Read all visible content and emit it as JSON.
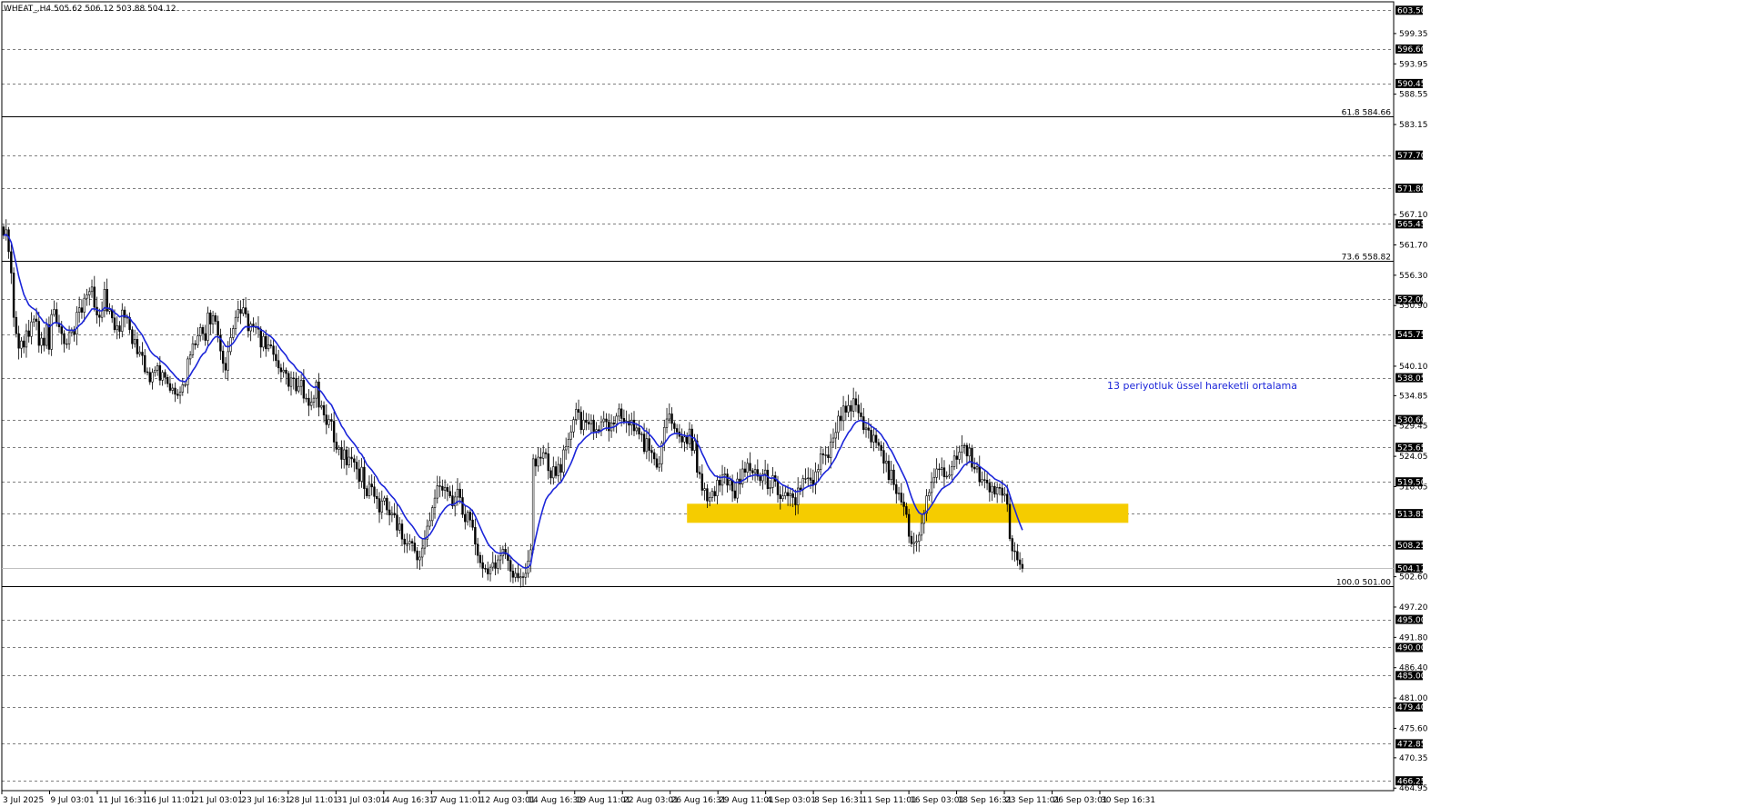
{
  "header": {
    "symbol_info": "WHEAT_,H4 505.62 506.12 503.88 504.12"
  },
  "annotation": {
    "ema_label": "13 periyotluk üssel hareketli ortalama"
  },
  "colors": {
    "background": "#ffffff",
    "candle": "#000000",
    "ema": "#1b25d9",
    "zone": "#f5cc00",
    "tag_bg": "#000000",
    "tag_text": "#ffffff",
    "grid": "#000000"
  },
  "chart_data": {
    "type": "candlestick",
    "symbol": "WHEAT_",
    "timeframe": "H4",
    "ylim": [
      464.5,
      605.0
    ],
    "y_ticks": [
      "599.35",
      "593.95",
      "588.55",
      "583.15",
      "567.10",
      "561.70",
      "556.30",
      "550.90",
      "540.10",
      "534.85",
      "529.45",
      "524.05",
      "518.65",
      "502.60",
      "497.20",
      "491.80",
      "486.40",
      "481.00",
      "475.60",
      "470.35",
      "464.95"
    ],
    "level_tags": [
      {
        "price": 603.5,
        "label": "603.50"
      },
      {
        "price": 596.6,
        "label": "596.60"
      },
      {
        "price": 590.45,
        "label": "590.45"
      },
      {
        "price": 577.7,
        "label": "577.70"
      },
      {
        "price": 571.8,
        "label": "571.80"
      },
      {
        "price": 565.45,
        "label": "565.45"
      },
      {
        "price": 552.0,
        "label": "552.00"
      },
      {
        "price": 545.75,
        "label": "545.75"
      },
      {
        "price": 538.05,
        "label": "538.05"
      },
      {
        "price": 530.6,
        "label": "530.60"
      },
      {
        "price": 525.65,
        "label": "525.65"
      },
      {
        "price": 519.5,
        "label": "519.50"
      },
      {
        "price": 513.85,
        "label": "513.85"
      },
      {
        "price": 508.25,
        "label": "508.25"
      },
      {
        "price": 504.12,
        "label": "504.12"
      },
      {
        "price": 495.0,
        "label": "495.00"
      },
      {
        "price": 490.0,
        "label": "490.00"
      },
      {
        "price": 485.0,
        "label": "485.00"
      },
      {
        "price": 479.4,
        "label": "479.40"
      },
      {
        "price": 472.85,
        "label": "472.85"
      },
      {
        "price": 466.25,
        "label": "466.25"
      }
    ],
    "dashed_levels": [
      603.5,
      596.6,
      590.45,
      577.7,
      571.8,
      565.45,
      552.0,
      545.75,
      538.05,
      530.6,
      525.65,
      519.5,
      513.85,
      508.25,
      495.0,
      490.0,
      485.0,
      479.4,
      472.85,
      466.25
    ],
    "current_price": 504.12,
    "fib_levels": [
      {
        "price": 584.66,
        "label": "61.8 584.66"
      },
      {
        "price": 558.82,
        "label": "73.6 558.82"
      },
      {
        "price": 501.0,
        "label": "100.0 501.00"
      }
    ],
    "x_labels": [
      "3 Jul 2025",
      "9 Jul 03:01",
      "11 Jul 16:31",
      "16 Jul 11:01",
      "21 Jul 03:01",
      "23 Jul 16:31",
      "28 Jul 11:01",
      "31 Jul 03:01",
      "4 Aug 16:31",
      "7 Aug 11:01",
      "12 Aug 03:01",
      "14 Aug 16:31",
      "19 Aug 11:01",
      "22 Aug 03:01",
      "26 Aug 16:31",
      "29 Aug 11:01",
      "4 Sep 03:01",
      "8 Sep 16:31",
      "11 Sep 11:01",
      "16 Sep 03:01",
      "18 Sep 16:31",
      "23 Sep 11:01",
      "26 Sep 03:01",
      "30 Sep 16:31"
    ],
    "zone": {
      "top": 515.6,
      "bottom": 512.2,
      "start_bar": 271,
      "end_bar": 446
    },
    "ema_label": "13 periyotluk üssel hareketli ortalama",
    "closes": [
      563.4,
      564.4,
      560.5,
      556.7,
      548.8,
      545.9,
      543.3,
      544.6,
      543.5,
      546.4,
      545.4,
      548.0,
      548.5,
      548.1,
      543.8,
      545.1,
      543.8,
      547.5,
      543.1,
      549.3,
      550.2,
      547.8,
      547.1,
      545.9,
      544.1,
      544.1,
      546.1,
      546.6,
      545.8,
      549.7,
      550.5,
      549.7,
      552.2,
      552.8,
      553.4,
      554.2,
      550.6,
      549.2,
      548.8,
      550.0,
      553.8,
      549.9,
      550.2,
      548.7,
      546.6,
      547.3,
      546.3,
      550.1,
      548.8,
      548.8,
      546.6,
      544.1,
      544.9,
      542.3,
      542.6,
      542.0,
      539.1,
      539.0,
      537.3,
      539.0,
      539.4,
      540.2,
      537.6,
      539.0,
      538.1,
      537.0,
      535.8,
      536.2,
      535.1,
      534.9,
      535.5,
      536.8,
      536.8,
      541.4,
      542.1,
      544.1,
      543.9,
      545.5,
      547.0,
      545.9,
      544.7,
      549.6,
      547.6,
      549.1,
      548.1,
      545.6,
      542.8,
      540.6,
      539.4,
      542.7,
      545.2,
      546.8,
      548.8,
      550.2,
      549.5,
      550.5,
      549.4,
      546.4,
      547.6,
      547.1,
      547.1,
      546.7,
      543.5,
      545.4,
      543.2,
      543.9,
      543.7,
      542.2,
      541.1,
      539.8,
      539.1,
      539.4,
      538.8,
      536.5,
      538.0,
      537.9,
      535.7,
      536.5,
      537.6,
      534.4,
      534.4,
      533.1,
      533.7,
      534.4,
      537.3,
      532.8,
      533.1,
      531.4,
      529.7,
      530.6,
      530.3,
      526.6,
      525.3,
      525.6,
      523.5,
      525.2,
      522.5,
      523.9,
      523.6,
      523.0,
      521.8,
      519.6,
      522.1,
      518.3,
      517.0,
      519.1,
      518.6,
      516.9,
      516.5,
      514.1,
      516.1,
      516.6,
      514.5,
      513.6,
      513.9,
      513.6,
      510.9,
      512.0,
      509.3,
      508.4,
      508.5,
      508.9,
      508.6,
      507.2,
      505.6,
      506.1,
      507.7,
      509.3,
      511.6,
      512.6,
      514.9,
      516.6,
      518.8,
      518.7,
      518.0,
      518.5,
      517.8,
      517.0,
      515.2,
      516.8,
      518.2,
      516.7,
      513.7,
      512.4,
      514.1,
      512.7,
      511.4,
      508.4,
      506.4,
      505.1,
      504.1,
      504.0,
      503.1,
      504.3,
      505.1,
      504.1,
      505.6,
      506.3,
      507.5,
      506.6,
      505.5,
      503.6,
      502.5,
      503.2,
      502.4,
      502.6,
      502.5,
      503.2,
      505.4,
      507.4,
      523.6,
      522.3,
      523.9,
      523.7,
      524.7,
      524.5,
      521.5,
      520.2,
      522.2,
      520.6,
      522.6,
      521.2,
      525.2,
      525.8,
      527.1,
      528.4,
      530.6,
      532.4,
      531.9,
      528.8,
      530.5,
      530.1,
      529.8,
      530.5,
      528.5,
      528.8,
      528.6,
      530.2,
      530.7,
      530.2,
      528.6,
      530.0,
      529.8,
      531.2,
      532.5,
      530.8,
      530.2,
      530.3,
      529.6,
      530.5,
      528.6,
      529.1,
      528.0,
      528.0,
      524.9,
      527.2,
      525.1,
      524.7,
      523.6,
      522.1,
      522.7,
      526.4,
      529.2,
      530.7,
      531.6,
      529.9,
      529.0,
      528.4,
      527.6,
      526.6,
      527.5,
      526.3,
      528.9,
      525.1,
      526.8,
      521.2,
      520.9,
      518.0,
      518.3,
      516.1,
      516.7,
      517.8,
      517.0,
      519.8,
      518.9,
      520.7,
      520.9,
      518.9,
      519.8,
      517.9,
      516.6,
      520.0,
      519.1,
      521.8,
      521.2,
      522.8,
      521.5,
      521.1,
      521.7,
      520.5,
      519.7,
      520.9,
      521.6,
      518.3,
      518.5,
      520.6,
      519.6,
      517.2,
      516.5,
      517.0,
      517.6,
      517.0,
      517.4,
      516.7,
      515.4,
      518.4,
      518.1,
      520.1,
      520.1,
      520.2,
      519.8,
      519.0,
      521.3,
      521.7,
      524.5,
      524.3,
      524.3,
      523.8,
      526.6,
      527.3,
      528.3,
      531.2,
      530.4,
      533.0,
      531.9,
      533.1,
      532.1,
      534.3,
      533.2,
      531.8,
      531.1,
      528.8,
      529.1,
      528.7,
      526.6,
      527.8,
      526.5,
      526.0,
      525.1,
      522.8,
      523.2,
      519.9,
      521.6,
      519.0,
      517.4,
      517.5,
      515.9,
      515.1,
      513.7,
      509.8,
      508.5,
      508.7,
      508.9,
      510.0,
      512.1,
      513.9,
      517.0,
      517.6,
      519.4,
      520.3,
      521.8,
      521.7,
      522.0,
      520.4,
      520.5,
      520.7,
      522.2,
      524.1,
      523.5,
      524.8,
      525.9,
      526.0,
      524.1,
      525.5,
      522.1,
      521.8,
      522.2,
      519.5,
      519.9,
      519.8,
      519.3,
      517.7,
      518.7,
      517.3,
      518.5,
      518.4,
      517.1,
      517.3,
      515.5,
      509.4,
      507.2,
      507.1,
      505.6,
      504.8,
      504.1
    ]
  }
}
